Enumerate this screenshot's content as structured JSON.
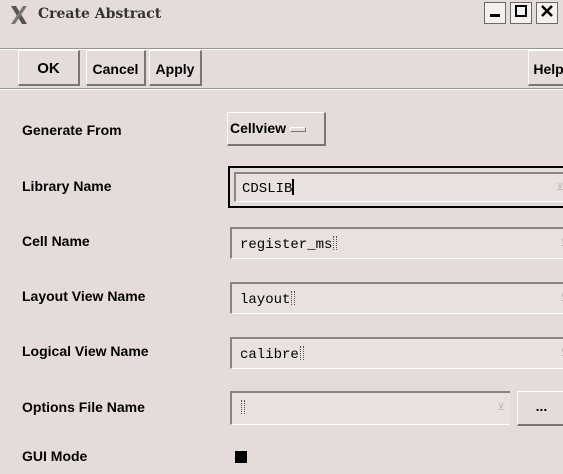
{
  "window": {
    "title": "Create Abstract",
    "icon": "x-window-icon",
    "controls": {
      "minimize_icon": "minimize-icon",
      "maximize_icon": "maximize-icon",
      "close_icon": "close-icon"
    }
  },
  "toolbar": {
    "ok_label": "OK",
    "cancel_label": "Cancel",
    "apply_label": "Apply",
    "help_label": "Help"
  },
  "form": {
    "generate_from": {
      "label": "Generate From",
      "value": "Cellview"
    },
    "library_name": {
      "label": "Library Name",
      "value": "CDSLIB"
    },
    "cell_name": {
      "label": "Cell Name",
      "value": "register_ms"
    },
    "layout_view_name": {
      "label": "Layout View Name",
      "value": "layout"
    },
    "logical_view_name": {
      "label": "Logical View Name",
      "value": "calibre"
    },
    "options_file_name": {
      "label": "Options File Name",
      "value": "",
      "browse_label": "..."
    },
    "gui_mode": {
      "label": "GUI Mode",
      "checked": true
    }
  },
  "colors": {
    "background": "#e5dcd9",
    "field": "#e8e1de",
    "shadow": "#7a7570",
    "highlight": "#ffffff"
  }
}
